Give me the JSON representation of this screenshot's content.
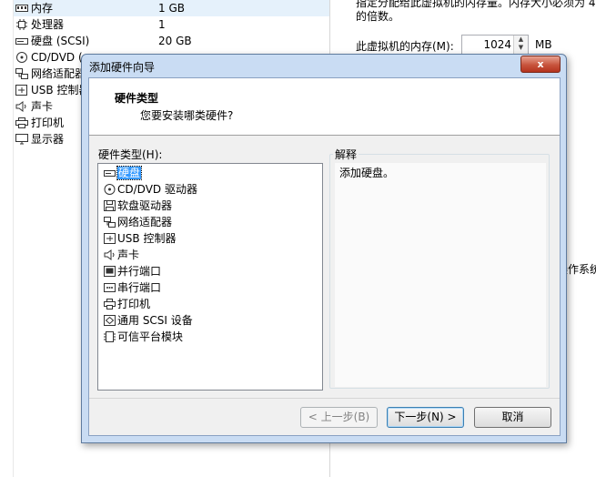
{
  "background": {
    "devices": [
      {
        "icon": "memory-icon",
        "name": "内存",
        "summary": "1 GB"
      },
      {
        "icon": "processor-icon",
        "name": "处理器",
        "summary": "1"
      },
      {
        "icon": "hard-disk-icon",
        "name": "硬盘 (SCSI)",
        "summary": "20 GB"
      },
      {
        "icon": "cd-dvd-icon",
        "name": "CD/DVD (",
        "summary": ""
      },
      {
        "icon": "network-adapter-icon",
        "name": "网络适配器",
        "summary": ""
      },
      {
        "icon": "usb-controller-icon",
        "name": "USB 控制器",
        "summary": ""
      },
      {
        "icon": "sound-card-icon",
        "name": "声卡",
        "summary": ""
      },
      {
        "icon": "printer-icon",
        "name": "打印机",
        "summary": ""
      },
      {
        "icon": "display-icon",
        "name": "显示器",
        "summary": ""
      }
    ],
    "memory_hint_line1": "指定分配给此虚拟机的内存量。内存大小必须为 4",
    "memory_hint_line2": "的倍数。",
    "memory_label": "此虚拟机的内存(M):",
    "memory_value": "1024",
    "memory_unit": "MB",
    "partial_text": "操作系统"
  },
  "dialog": {
    "title": "添加硬件向导",
    "close_label": "x",
    "header_title": "硬件类型",
    "header_subtitle": "您要安装哪类硬件?",
    "list_label": "硬件类型(H):",
    "list_label_hotkey": "H",
    "items": [
      {
        "icon": "hard-disk-icon",
        "label": "硬盘",
        "selected": true
      },
      {
        "icon": "cd-dvd-icon",
        "label": "CD/DVD 驱动器"
      },
      {
        "icon": "floppy-icon",
        "label": "软盘驱动器"
      },
      {
        "icon": "network-adapter-icon",
        "label": "网络适配器"
      },
      {
        "icon": "usb-controller-icon",
        "label": "USB 控制器"
      },
      {
        "icon": "sound-card-icon",
        "label": "声卡"
      },
      {
        "icon": "parallel-port-icon",
        "label": "并行端口"
      },
      {
        "icon": "serial-port-icon",
        "label": "串行端口"
      },
      {
        "icon": "printer-icon",
        "label": "打印机"
      },
      {
        "icon": "scsi-device-icon",
        "label": "通用 SCSI 设备"
      },
      {
        "icon": "tpm-icon",
        "label": "可信平台模块"
      }
    ],
    "explain_legend": "解释",
    "explain_text": "添加硬盘。",
    "buttons": {
      "back": "< 上一步(B)",
      "next": "下一步(N) >",
      "cancel": "取消"
    }
  }
}
